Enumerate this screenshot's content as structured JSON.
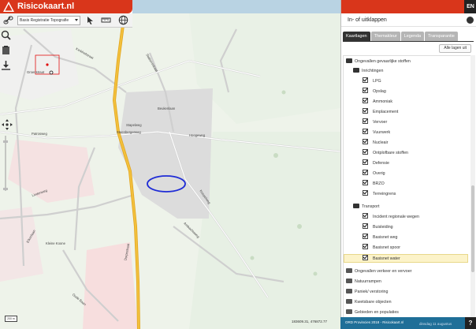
{
  "app": {
    "title": "Risicokaart.nl"
  },
  "toolbar": {
    "basemap_select": "Basis Registratie Topografie",
    "icons": [
      "link-icon",
      "pointer-icon",
      "measure-icon",
      "globe-icon"
    ]
  },
  "side_tools": [
    "zoom-in-icon",
    "clipboard-icon",
    "download-icon",
    "pan-control-icon"
  ],
  "map": {
    "labels": [
      "Groenstraat",
      "Kerkhofstraat",
      "Stationsstraat",
      "Stapelweg",
      "Steenbergerweg",
      "Beukenlaan",
      "Hoogeweg",
      "Patrosweg",
      "Koepelweg",
      "Dorpsstraat",
      "Eikenlaan",
      "Ambachtsweg",
      "Kleine Koone",
      "Lindenweg",
      "Oude Baan"
    ],
    "coords": "183609.31, 476872.77",
    "scale": "200 m",
    "colors": {
      "road_major": "#f2c03c",
      "forest": "#e6efe1",
      "farmland": "#f5e2e2",
      "urban": "#e0e0e0",
      "highlight": "#1f2cd6"
    }
  },
  "panel": {
    "language": "EN",
    "collapse_label": "In- of uitklappen",
    "tabs": [
      "Kaartlagen",
      "Themakleur",
      "Legenda",
      "Transparantie"
    ],
    "active_tab": "Kaartlagen",
    "all_off": "Alle lagen uit",
    "groups": [
      {
        "label": "Ongevallen gevaarlijke stoffen",
        "open": true,
        "subgroups": [
          {
            "label": "Inrichtingen",
            "open": true,
            "items": [
              "LPG",
              "Opslag",
              "Ammoniak",
              "Emplacement",
              "Vervoer",
              "Vuurwerk",
              "Nucleair",
              "Ontplofbare stoffen",
              "Defensie",
              "Overig",
              "BRZO",
              "Terreingrens"
            ]
          },
          {
            "label": "Transport",
            "open": true,
            "items": [
              "Incident regionale wegen",
              "Buisleiding",
              "Basisnet weg",
              "Basisnet spoor",
              "Basisnet water"
            ]
          }
        ]
      },
      {
        "label": "Ongevallen verkeer en vervoer",
        "open": false
      },
      {
        "label": "Natuurrampen",
        "open": false
      },
      {
        "label": "Paniek/ verstoring",
        "open": false
      },
      {
        "label": "Kwetsbare objecten",
        "open": false
      },
      {
        "label": "Gebieden en populaties",
        "open": false
      }
    ],
    "highlighted_item": "Basisnet water",
    "footer": "ORD Provincies 2018 - Risicokaart.nl",
    "footer_date": "dinsdag 11 augustus",
    "help": "?"
  }
}
